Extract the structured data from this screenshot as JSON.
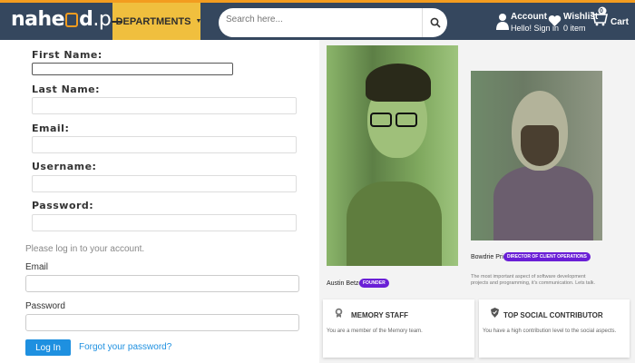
{
  "header": {
    "logo_main": "nahe",
    "logo_mid": "d",
    "logo_tld": ".pk",
    "departments_label": "DEPARTMENTS",
    "search_placeholder": "Search here...",
    "account_title": "Account",
    "account_sub": "Hello! Sign in",
    "wishlist_title": "Wishlist",
    "wishlist_sub": "0 item",
    "cart_label": "Cart",
    "cart_count": "0",
    "accent_color": "#f39c1f",
    "bar_color": "#35475e"
  },
  "register_form": {
    "first_name_label": "First Name:",
    "last_name_label": "Last Name:",
    "email_label": "Email:",
    "username_label": "Username:",
    "password_label": "Password:"
  },
  "login_form": {
    "prompt": "Please log in to your account.",
    "email_label": "Email",
    "password_label": "Password",
    "login_button": "Log In",
    "forgot_link": "Forgot your password?"
  },
  "team": [
    {
      "name": "Austin Betzer",
      "role_badge": "FOUNDER"
    },
    {
      "name": "Bowdrie Price",
      "role_badge": "DIRECTOR OF CLIENT OPERATIONS",
      "description": "The most important aspect of software development projects and programming, it's communication. Lets talk."
    }
  ],
  "badges": [
    {
      "title": "MEMORY STAFF",
      "subtitle": "You are a member of the Memory team.",
      "icon": "badge-icon"
    },
    {
      "title": "TOP SOCIAL CONTRIBUTOR",
      "subtitle": "You have a high contribution level to the social aspects.",
      "icon": "shield-icon"
    }
  ]
}
